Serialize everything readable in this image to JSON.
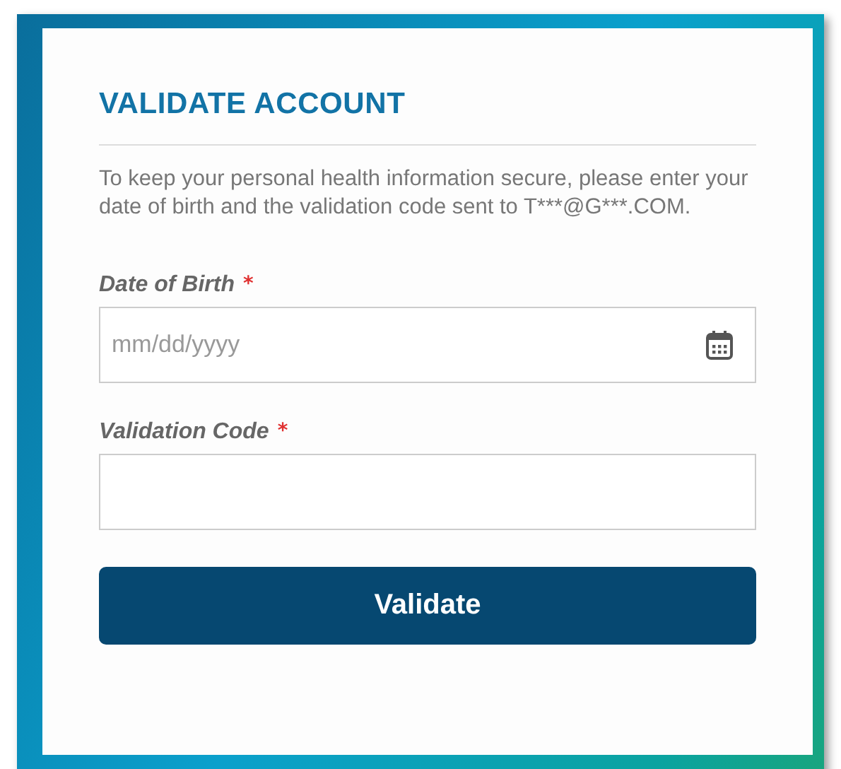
{
  "title": "VALIDATE ACCOUNT",
  "intro": "To keep your personal health information secure, please enter your date of birth and the validation code sent to T***@G***.COM.",
  "fields": [
    {
      "kind": "date",
      "label": "Date of Birth",
      "required_mark": "*",
      "placeholder": "mm/dd/yyyy"
    },
    {
      "kind": "text",
      "label": "Validation Code",
      "required_mark": "*"
    }
  ],
  "button": "Validate"
}
